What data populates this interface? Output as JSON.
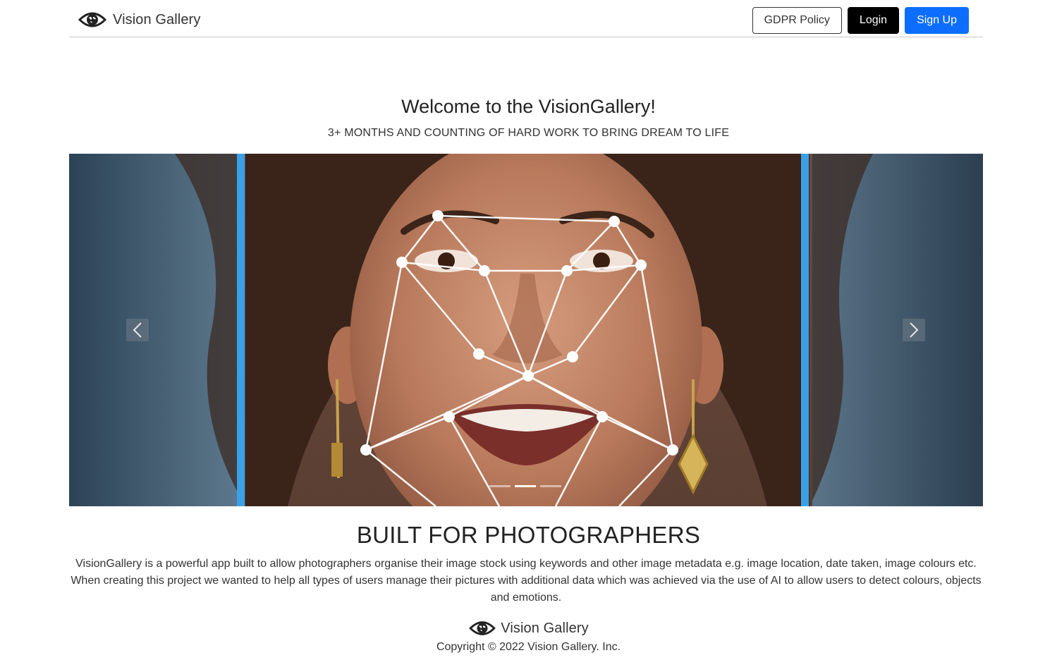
{
  "navbar": {
    "brand": "Vision Gallery",
    "gdpr_label": "GDPR Policy",
    "login_label": "Login",
    "signup_label": "Sign Up"
  },
  "hero": {
    "title": "Welcome to the VisionGallery!",
    "subtitle": "3+ MONTHS AND COUNTING OF HARD WORK TO BRING DREAM TO LIFE"
  },
  "carousel": {
    "slide_count": 3,
    "active_slide": 2,
    "image_subject": "face-landmark-detection-photo",
    "prev_icon": "chevron-left-icon",
    "next_icon": "chevron-right-icon"
  },
  "about": {
    "title": "BUILT FOR PHOTOGRAPHERS",
    "body": "VisionGallery is a powerful app built to allow photographers organise their image stock using keywords and other image metadata e.g. image location, date taken, image colours etc. When creating this project we wanted to help all types of users manage their pictures with additional data which was achieved via the use of AI to allow users to detect colours, objects and emotions."
  },
  "footer": {
    "brand": "Vision Gallery",
    "copyright": "Copyright © 2022 Vision Gallery. Inc."
  },
  "colors": {
    "primary": "#0d6efd",
    "dark": "#000000",
    "accent_bar": "#3aa0e8"
  }
}
